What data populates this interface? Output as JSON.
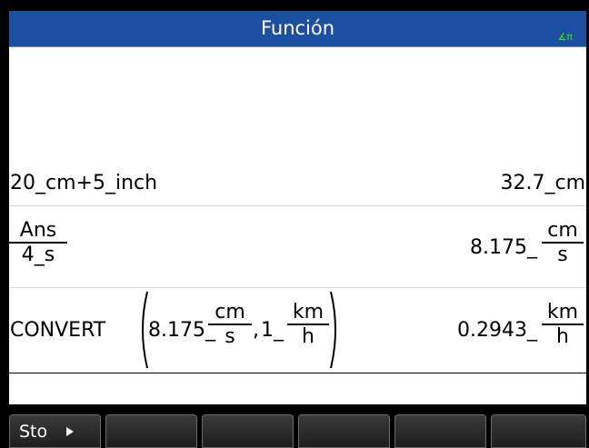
{
  "title": "Función",
  "angle_indicator": "∡π",
  "history": {
    "entry1": {
      "expr": "20_cm+5_inch",
      "result": "32.7_cm"
    },
    "entry2": {
      "expr_num": "Ans",
      "expr_den": "4_s",
      "result_prefix": "8.175_",
      "result_num": "cm",
      "result_den": "s"
    },
    "entry3": {
      "expr_func": "CONVERT",
      "arg1_prefix": "8.175_",
      "arg1_num": "cm",
      "arg1_den": "s",
      "comma": ",",
      "arg2_prefix": "1_",
      "arg2_num": "km",
      "arg2_den": "h",
      "result_prefix": "0.2943_",
      "result_num": "km",
      "result_den": "h"
    }
  },
  "menu": {
    "sto_label": "Sto"
  }
}
